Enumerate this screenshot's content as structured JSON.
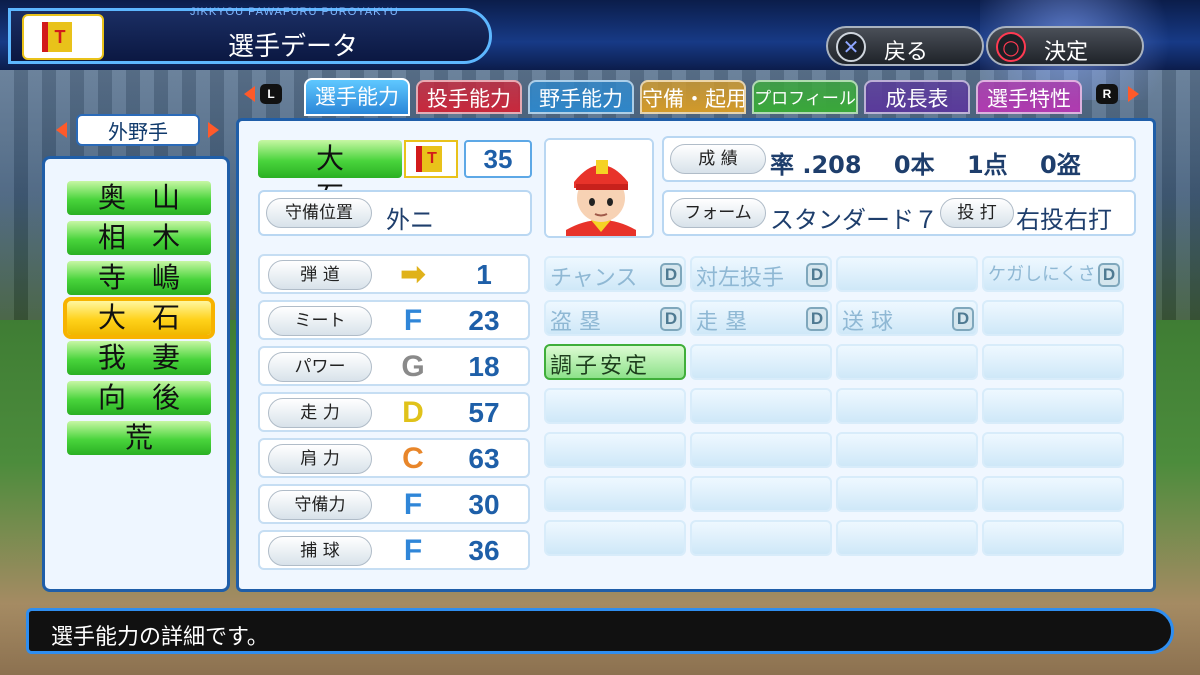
{
  "header": {
    "romaji": "JIKKYOU PAWAFURU PUROYAKYU",
    "title": "選手データ",
    "team_logo_letter": "T",
    "back_button": {
      "glyph": "✕",
      "label": "戻る"
    },
    "ok_button": {
      "glyph": "○",
      "label": "決定"
    }
  },
  "tabs": {
    "left_key": "L",
    "right_key": "R",
    "items": [
      {
        "label": "選手能力",
        "color": "#2a86d8",
        "active": true
      },
      {
        "label": "投手能力",
        "color": "#c8283c"
      },
      {
        "label": "野手能力",
        "color": "#2f86c8"
      },
      {
        "label": "守備・起用",
        "color": "#d29a2a"
      },
      {
        "label": "プロフィール",
        "color": "#3aa83a"
      },
      {
        "label": "成長表",
        "color": "#5a3a9a"
      },
      {
        "label": "選手特性",
        "color": "#b03ab0"
      }
    ]
  },
  "position_selector": {
    "label": "外野手"
  },
  "players": [
    {
      "name": "奥山"
    },
    {
      "name": "相木"
    },
    {
      "name": "寺嶋"
    },
    {
      "name": "大石",
      "selected": true
    },
    {
      "name": "我妻"
    },
    {
      "name": "向後"
    },
    {
      "name": "荒"
    }
  ],
  "profile": {
    "name": "大石",
    "team_letter": "T",
    "number": "35",
    "position_label": "守備位置",
    "position_value": "外ニ",
    "record_label": "成 績",
    "record_value": "率 .208　 0本　 1点　 0盗",
    "form_label": "フォーム",
    "form_value": "スタンダード７",
    "throw_bat_label": "投 打",
    "throw_bat_value": "右投右打"
  },
  "stats": [
    {
      "label": "弾 道",
      "grade": "➡",
      "value": "1",
      "color": "#e0b21a"
    },
    {
      "label": "ミート",
      "grade": "F",
      "value": "23",
      "color": "#2f86d8"
    },
    {
      "label": "パワー",
      "grade": "G",
      "value": "18",
      "color": "#8a8a8a"
    },
    {
      "label": "走 力",
      "grade": "D",
      "value": "57",
      "color": "#e0c21a"
    },
    {
      "label": "肩 力",
      "grade": "C",
      "value": "63",
      "color": "#e8862a"
    },
    {
      "label": "守備力",
      "grade": "F",
      "value": "30",
      "color": "#2f86d8"
    },
    {
      "label": "捕 球",
      "grade": "F",
      "value": "36",
      "color": "#2f86d8"
    }
  ],
  "abilities": [
    {
      "text": "チャンス",
      "rank": "D"
    },
    {
      "text": "対左投手",
      "rank": "D"
    },
    {
      "text": "",
      "rank": ""
    },
    {
      "text": "ケガしにくさ",
      "rank": "D"
    },
    {
      "text": "盗 塁",
      "rank": "D"
    },
    {
      "text": "走 塁",
      "rank": "D"
    },
    {
      "text": "送 球",
      "rank": "D"
    },
    {
      "text": "",
      "rank": ""
    },
    {
      "text": "調子安定",
      "rank": "",
      "special": true
    }
  ],
  "message": "選手能力の詳細です。"
}
